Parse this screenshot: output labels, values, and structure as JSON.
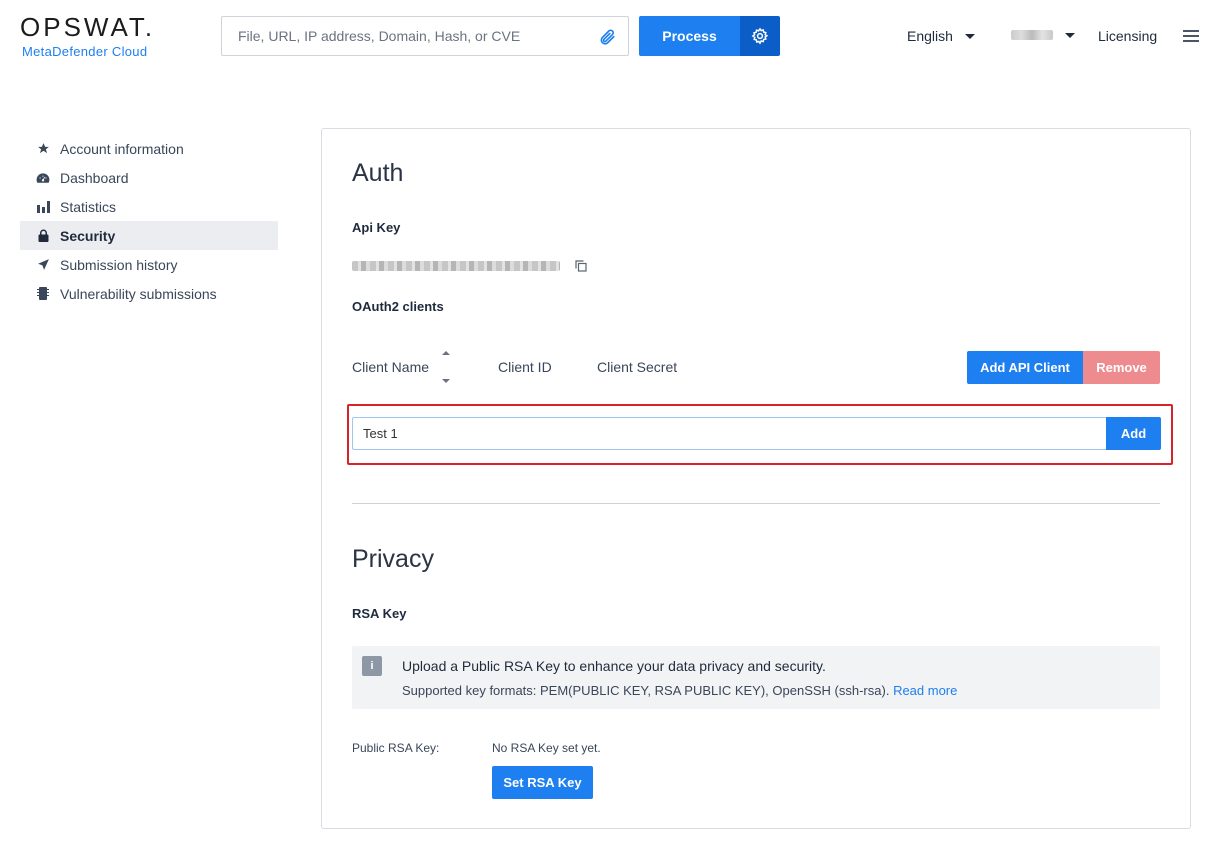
{
  "header": {
    "logo_text": "OPSWAT.",
    "logo_sub": "MetaDefender Cloud",
    "search_placeholder": "File, URL, IP address, Domain, Hash, or CVE",
    "process_label": "Process",
    "language": "English",
    "licensing_label": "Licensing"
  },
  "sidebar": {
    "items": [
      {
        "label": "Account information",
        "icon": "star-icon"
      },
      {
        "label": "Dashboard",
        "icon": "dashboard-icon"
      },
      {
        "label": "Statistics",
        "icon": "bar-chart-icon"
      },
      {
        "label": "Security",
        "icon": "lock-icon",
        "active": true
      },
      {
        "label": "Submission history",
        "icon": "paper-plane-icon"
      },
      {
        "label": "Vulnerability submissions",
        "icon": "chip-icon"
      }
    ]
  },
  "auth": {
    "title": "Auth",
    "api_key_label": "Api Key",
    "oauth_label": "OAuth2 clients",
    "columns": [
      "Client Name",
      "Client ID",
      "Client Secret"
    ],
    "add_client_label": "Add API Client",
    "remove_label": "Remove",
    "client_input_value": "Test 1",
    "add_label": "Add"
  },
  "privacy": {
    "title": "Privacy",
    "rsa_label": "RSA Key",
    "info_title": "Upload a Public RSA Key to enhance your data privacy and security.",
    "info_sub": "Supported key formats: PEM(PUBLIC KEY, RSA PUBLIC KEY), OpenSSH (ssh-rsa).",
    "read_more": "Read more",
    "public_key_label": "Public RSA Key:",
    "public_key_value": "No RSA Key set yet.",
    "set_key_label": "Set RSA Key"
  },
  "colors": {
    "primary": "#1d7ff0",
    "primary_dark": "#0b5ec7",
    "danger_light": "#ee8b8f",
    "highlight": "#d8232a"
  }
}
